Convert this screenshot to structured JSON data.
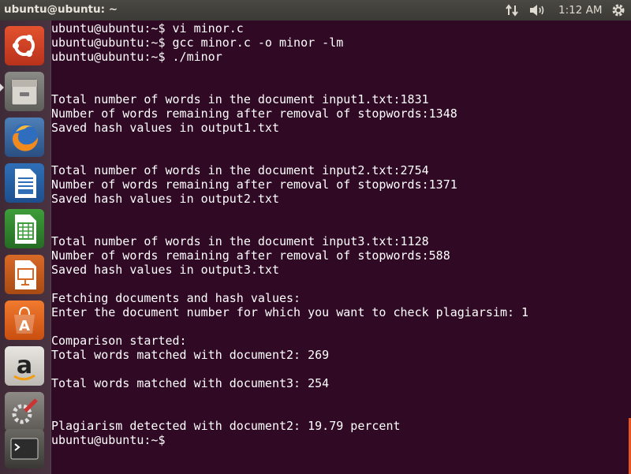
{
  "window": {
    "title": "ubuntu@ubuntu: ~"
  },
  "indicators": {
    "network_icon": "network-updown-icon",
    "sound_icon": "speaker-volume-icon",
    "clock": "1:12 AM",
    "session_icon": "gear-icon"
  },
  "launcher": {
    "items": [
      {
        "name": "dash-home-icon"
      },
      {
        "name": "files-icon"
      },
      {
        "name": "firefox-icon"
      },
      {
        "name": "libreoffice-writer-icon"
      },
      {
        "name": "libreoffice-calc-icon"
      },
      {
        "name": "libreoffice-impress-icon"
      },
      {
        "name": "software-center-icon"
      },
      {
        "name": "amazon-icon"
      },
      {
        "name": "system-settings-icon"
      },
      {
        "name": "terminal-icon"
      }
    ]
  },
  "terminal": {
    "lines": [
      "ubuntu@ubuntu:~$ vi minor.c",
      "ubuntu@ubuntu:~$ gcc minor.c -o minor -lm",
      "ubuntu@ubuntu:~$ ./minor",
      "",
      "",
      "Total number of words in the document input1.txt:1831",
      "Number of words remaining after removal of stopwords:1348",
      "Saved hash values in output1.txt",
      "",
      "",
      "Total number of words in the document input2.txt:2754",
      "Number of words remaining after removal of stopwords:1371",
      "Saved hash values in output2.txt",
      "",
      "",
      "Total number of words in the document input3.txt:1128",
      "Number of words remaining after removal of stopwords:588",
      "Saved hash values in output3.txt",
      "",
      "Fetching documents and hash values:",
      "Enter the document number for which you want to check plagiarsim: 1",
      "",
      "Comparison started:",
      "Total words matched with document2: 269",
      "",
      "Total words matched with document3: 254",
      "",
      "",
      "Plagiarism detected with document2: 19.79 percent",
      "ubuntu@ubuntu:~$ "
    ]
  },
  "colors": {
    "terminal_bg": "#300a24",
    "terminal_fg": "#ffffff",
    "accent": "#e95420"
  }
}
